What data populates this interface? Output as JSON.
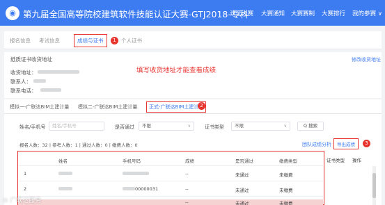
{
  "header": {
    "logo": "◉",
    "title": "第九届全国高等院校建筑软件技能认证大赛-GTJ2018-专科",
    "nav": [
      "认证大赛",
      "大赛通知",
      "大赛赛制",
      "大赛排行",
      "我的参赛 ∨"
    ]
  },
  "top_tabs": {
    "items": [
      "报名信息",
      "考试信息",
      "成绩与证书",
      "个人证书"
    ],
    "active_index": 2,
    "step_badge": "1"
  },
  "address": {
    "section_title": "纸质证书收货地址",
    "fields": [
      "收货地址：",
      "联系人：",
      "联系电话："
    ],
    "edit_link": "修改收货地址",
    "note": "填写收货地址才能查看成绩"
  },
  "exam_tabs": {
    "items": [
      "模拟一-广联达BIM土建计量",
      "模拟二-广联达BIM土建计量",
      "正式-广联达BIM土建计量"
    ],
    "active_index": 2,
    "step_badge": "2"
  },
  "filters": {
    "name_label": "姓名/手机号",
    "name_placeholder": "姓名/手机号",
    "pass_label": "是否通过",
    "pass_value": "不限",
    "cert_label": "证书类型",
    "cert_value": "不限",
    "search_button": "Q 搜索",
    "chev": "∨"
  },
  "stats": {
    "text": "报名人数：32  |  参考人数：1  |  通过人数：0  |  缴费人数：0",
    "team_link": "团队成绩分析",
    "export_button": "导出成绩",
    "step_badge": "3"
  },
  "table": {
    "headers": [
      "姓名",
      "手机号码",
      "成绩",
      "是否通过",
      "缴费类型"
    ],
    "extra_headers": [
      "证书类型",
      "操作"
    ],
    "rows": [
      {
        "index": "1",
        "phone": "",
        "score": "--",
        "passed": "未通过",
        "payment": "未缴费"
      },
      {
        "index": "2",
        "phone": "00000031",
        "score": "--",
        "passed": "未通过",
        "payment": "未缴费"
      },
      {
        "index": "",
        "phone": "",
        "score": "--",
        "passed": "未通过",
        "payment": "未缴费"
      }
    ]
  },
  "watermark": "⊙ 广联达服务",
  "colors": {
    "brand": "#3d7bf0",
    "annotation": "#e8342f"
  }
}
